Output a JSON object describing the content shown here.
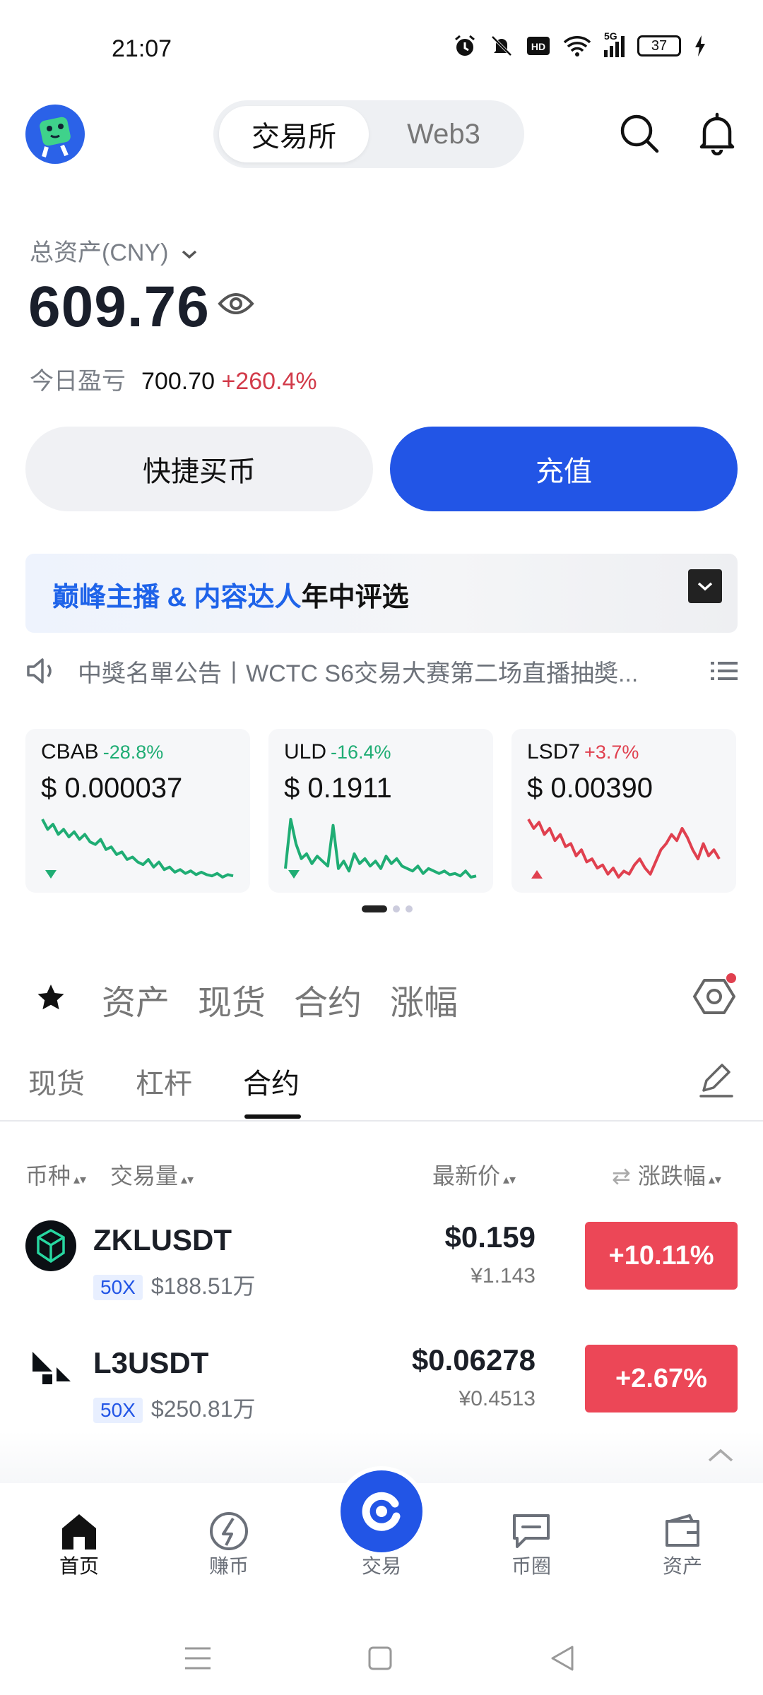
{
  "status": {
    "time": "21:07",
    "network": "5G",
    "battery": "37"
  },
  "header": {
    "tabs": [
      {
        "label": "交易所"
      },
      {
        "label": "Web3"
      }
    ]
  },
  "assets": {
    "label": "总资产(CNY)",
    "value": "609.76",
    "pnl_label": "今日盈亏",
    "pnl_value": "700.70",
    "pnl_pct": "+260.4%"
  },
  "actions": {
    "buy": "快捷买币",
    "deposit": "充值"
  },
  "banner": {
    "highlight": "巅峰主播 & 内容达人",
    "rest": "年中评选"
  },
  "notice": {
    "text": "中獎名單公告丨WCTC S6交易大赛第二场直播抽奬..."
  },
  "cards": [
    {
      "symbol": "CBAB",
      "change": "-28.8%",
      "direction": "down",
      "price": "$ 0.000037",
      "color": "#1fad74",
      "spark": [
        78,
        70,
        74,
        66,
        70,
        64,
        68,
        62,
        66,
        60,
        58,
        62,
        54,
        56,
        50,
        52,
        46,
        48,
        44,
        42,
        46,
        40,
        44,
        38,
        40,
        36,
        38,
        35,
        37,
        34,
        36,
        34,
        33,
        35,
        32,
        34,
        33
      ]
    },
    {
      "symbol": "ULD",
      "change": "-16.4%",
      "direction": "down",
      "price": "$ 0.1911",
      "color": "#1fad74",
      "spark": [
        40,
        80,
        60,
        48,
        52,
        44,
        50,
        46,
        42,
        75,
        40,
        46,
        38,
        52,
        44,
        48,
        42,
        46,
        40,
        50,
        44,
        48,
        42,
        40,
        38,
        42,
        36,
        40,
        38,
        36,
        38,
        35,
        36,
        34,
        38,
        33,
        34
      ]
    },
    {
      "symbol": "LSD7",
      "change": "+3.7%",
      "direction": "up",
      "price": "$ 0.00390",
      "color": "#e0404f",
      "spark": [
        76,
        70,
        74,
        66,
        70,
        62,
        66,
        58,
        60,
        52,
        56,
        48,
        50,
        44,
        46,
        40,
        44,
        38,
        42,
        40,
        46,
        50,
        44,
        40,
        48,
        56,
        60,
        66,
        62,
        70,
        64,
        56,
        50,
        60,
        52,
        56,
        50
      ]
    }
  ],
  "categories": {
    "items": [
      "资产",
      "现货",
      "合约",
      "涨幅"
    ]
  },
  "subtabs": {
    "items": [
      "现货",
      "杠杆",
      "合约"
    ]
  },
  "table": {
    "headers": {
      "coin": "币种",
      "volume": "交易量",
      "price": "最新价",
      "change": "涨跌幅"
    },
    "rows": [
      {
        "symbol": "ZKLUSDT",
        "leverage": "50X",
        "volume": "$188.51万",
        "price": "$0.159",
        "cny": "¥1.143",
        "change": "+10.11%"
      },
      {
        "symbol": "L3USDT",
        "leverage": "50X",
        "volume": "$250.81万",
        "price": "$0.06278",
        "cny": "¥0.4513",
        "change": "+2.67%"
      }
    ]
  },
  "nav": {
    "items": [
      {
        "label": "首页"
      },
      {
        "label": "赚币"
      },
      {
        "label": "交易"
      },
      {
        "label": "币圈"
      },
      {
        "label": "资产"
      }
    ]
  }
}
